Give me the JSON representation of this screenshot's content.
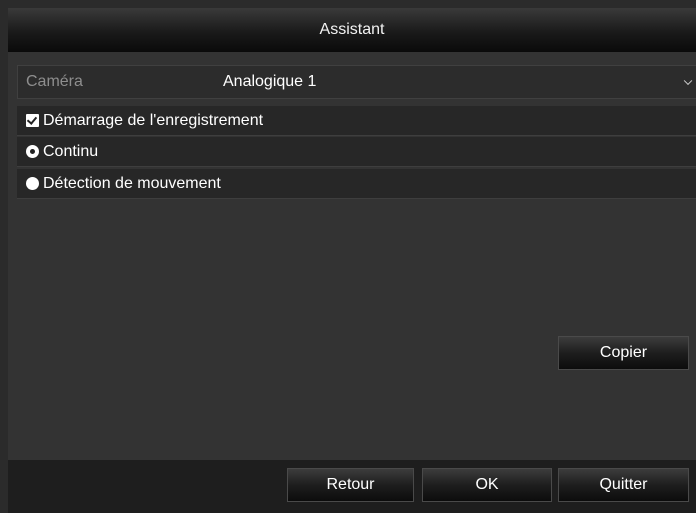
{
  "dialog": {
    "title": "Assistant"
  },
  "camera": {
    "label": "Caméra",
    "selected_value": "Analogique 1"
  },
  "options": {
    "record_start_label": "Démarrage de l'enregistrement",
    "record_start_checked": true,
    "continuous_label": "Continu",
    "continuous_selected": true,
    "motion_label": "Détection de mouvement",
    "motion_selected": false
  },
  "buttons": {
    "copy_label": "Copier",
    "back_label": "Retour",
    "ok_label": "OK",
    "quit_label": "Quitter"
  },
  "icons": {
    "checkbox": "checkbox-checked-icon",
    "radio_selected": "radio-selected-icon",
    "radio_unselected": "radio-unselected-icon",
    "dropdown": "chevron-down-icon"
  }
}
